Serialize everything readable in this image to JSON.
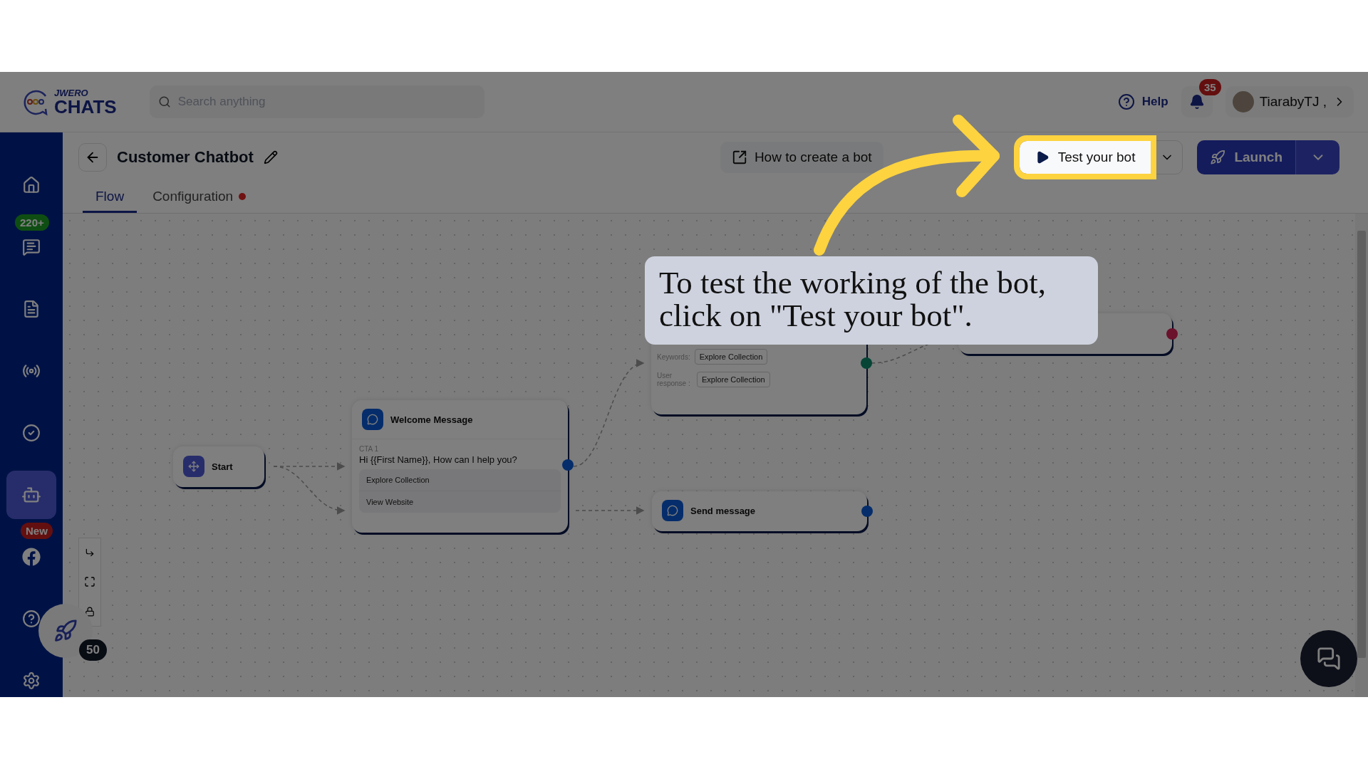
{
  "header": {
    "logo_top": "JWERO",
    "logo_bottom": "CHATS",
    "search": {
      "placeholder": "Search anything"
    },
    "help": "Help",
    "notifications": "35",
    "user": "TiarabyTJ ,"
  },
  "sidebar": {
    "items": [
      {
        "selected": false
      },
      {
        "selected": false,
        "badge": "220+"
      },
      {
        "selected": false
      },
      {
        "selected": false
      },
      {
        "selected": false
      },
      {
        "selected": true
      },
      {
        "selected": false,
        "badge": "New"
      },
      {
        "selected": false
      },
      {
        "selected": false
      }
    ]
  },
  "page": {
    "title": "Customer Chatbot",
    "actions": [
      {
        "kind": "guide",
        "label": "How to create a bot",
        "highlighted": false
      },
      {
        "kind": "test",
        "label": "Test your bot",
        "highlighted": true
      },
      {
        "kind": "launch",
        "label": "Launch",
        "highlighted": false
      }
    ]
  },
  "tabs": [
    {
      "label": "Flow",
      "selected": true,
      "dot": false
    },
    {
      "label": "Configuration",
      "selected": false,
      "dot": true
    }
  ],
  "nodes": [
    {
      "kind": "start",
      "title": "Start"
    },
    {
      "kind": "message",
      "title": "Welcome Message",
      "cta_label": "CTA 1",
      "message": "Hi {{First Name}}, How can I help you?",
      "buttons": [
        "Explore Collection",
        "View Website"
      ]
    },
    {
      "kind": "keyword",
      "keyword_label": "Keywords:",
      "keyword": "Explore Collection",
      "response_label": "User response :",
      "response": "Explore Collection"
    },
    {
      "kind": "blank"
    },
    {
      "kind": "send",
      "title": "Send message"
    }
  ],
  "zoom": "50",
  "callout": {
    "text": "To test the working of the bot, click on \"Test your bot\"."
  },
  "overlay": {
    "dimmed": true
  }
}
